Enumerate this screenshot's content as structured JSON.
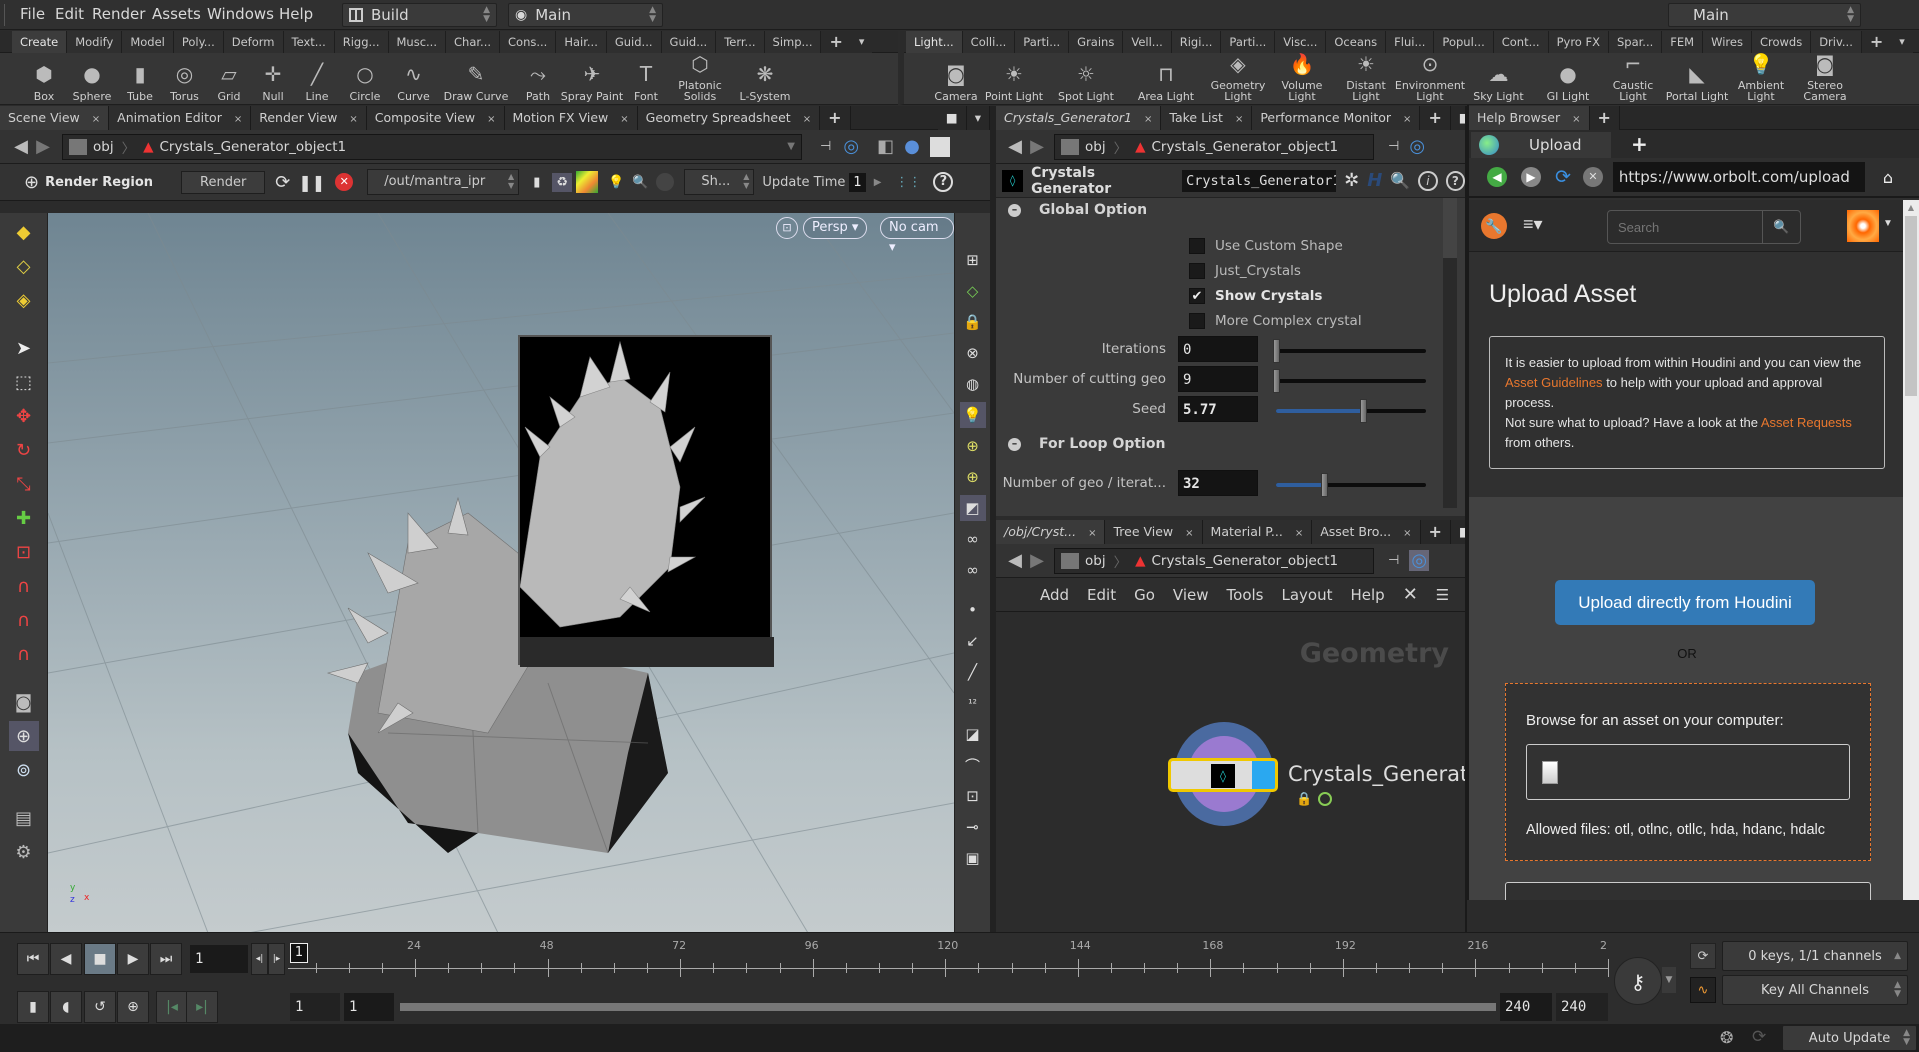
{
  "menubar": {
    "items": [
      "File",
      "Edit",
      "Render",
      "Assets",
      "Windows",
      "Help"
    ],
    "desktop": "Build",
    "context": "Main",
    "right_context": "Main"
  },
  "shelf_left": {
    "tabs": [
      "Create",
      "Modify",
      "Model",
      "Poly...",
      "Deform",
      "Text...",
      "Rigg...",
      "Musc...",
      "Char...",
      "Cons...",
      "Hair...",
      "Guid...",
      "Guid...",
      "Terr...",
      "Simp..."
    ],
    "active_tab": "Create",
    "tools": [
      "Box",
      "Sphere",
      "Tube",
      "Torus",
      "Grid",
      "Null",
      "Line",
      "Circle",
      "Curve",
      "Draw Curve",
      "Path",
      "Spray Paint",
      "Font",
      "Platonic Solids",
      "L-System"
    ]
  },
  "shelf_right": {
    "tabs": [
      "Light...",
      "Colli...",
      "Parti...",
      "Grains",
      "Vell...",
      "Rigi...",
      "Parti...",
      "Visc...",
      "Oceans",
      "Flui...",
      "Popul...",
      "Cont...",
      "Pyro FX",
      "Spar...",
      "FEM",
      "Wires",
      "Crowds",
      "Driv..."
    ],
    "active_tab": "Light...",
    "tools": [
      "Camera",
      "Point Light",
      "Spot Light",
      "Area Light",
      "Geometry Light",
      "Volume Light",
      "Distant Light",
      "Environment Light",
      "Sky Light",
      "GI Light",
      "Caustic Light",
      "Portal Light",
      "Ambient Light",
      "Stereo Camera"
    ]
  },
  "scene_pane": {
    "tabs": [
      "Scene View",
      "Animation Editor",
      "Render View",
      "Composite View",
      "Motion FX View",
      "Geometry Spreadsheet"
    ],
    "active_tab": "Scene View",
    "path": {
      "root": "obj",
      "node": "Crystals_Generator_object1"
    },
    "render_toolbar": {
      "render_region_label": "Render Region",
      "render_button": "Render",
      "output_driver": "/out/mantra_ipr",
      "shading_menu": "Sh...",
      "update_time_label": "Update Time",
      "update_time_value": "1"
    },
    "viewport": {
      "projection": "Persp",
      "camera": "No cam"
    }
  },
  "param_pane": {
    "tabs": [
      "Crystals_Generator1",
      "Take List",
      "Performance Monitor"
    ],
    "active_tab": "Crystals_Generator1",
    "path": {
      "root": "obj",
      "node": "Crystals_Generator_object1"
    },
    "node_type": "Crystals Generator",
    "node_name": "Crystals_Generator1",
    "sections": [
      {
        "title": "Global Option"
      },
      {
        "title": "For Loop Option"
      }
    ],
    "toggles": [
      {
        "label": "Use Custom Shape",
        "checked": false
      },
      {
        "label": "Just_Crystals",
        "checked": false
      },
      {
        "label": "Show Crystals",
        "checked": true
      },
      {
        "label": "More Complex crystal",
        "checked": false
      }
    ],
    "params": [
      {
        "label": "Iterations",
        "value": "0",
        "slider_fraction": 0.0
      },
      {
        "label": "Number of cutting geo",
        "value": "9",
        "slider_fraction": 0.0
      },
      {
        "label": "Seed",
        "value": "5.77",
        "slider_fraction": 0.577
      },
      {
        "label": "Number of geo / iterat...",
        "value": "32",
        "slider_fraction": 0.32
      }
    ]
  },
  "network_pane": {
    "tabs": [
      "/obj/Cryst...",
      "Tree View",
      "Material P...",
      "Asset Bro..."
    ],
    "active_tab": "/obj/Cryst...",
    "path": {
      "root": "obj",
      "node": "Crystals_Generator_object1"
    },
    "menu": [
      "Add",
      "Edit",
      "Go",
      "View",
      "Tools",
      "Layout",
      "Help"
    ],
    "context_label": "Geometry",
    "node_label": "Crystals_Generat"
  },
  "help_browser": {
    "pane_tab": "Help Browser",
    "browser_tab": "Upload",
    "url": "https://www.orbolt.com/upload",
    "search_placeholder": "Search",
    "heading": "Upload Asset",
    "info_text_1": "It is easier to upload from within Houdini and you can view the",
    "info_link_1": "Asset Guidelines",
    "info_text_2": "to help with your upload and approval process.",
    "info_text_3": "Not sure what to upload? Have a look at the",
    "info_link_2": "Asset Requests",
    "info_text_4": "from others.",
    "upload_button": "Upload directly from Houdini",
    "or_label": "OR",
    "browse_label": "Browse for an asset on your computer:",
    "allowed_files": "Allowed files: otl, otlnc, otllc, hda, hdanc, hdalc",
    "colors": {
      "link": "#e8772e",
      "button": "#337ab7",
      "dropzone_border": "#e8772e"
    }
  },
  "timeline": {
    "current_frame": "1",
    "frame_marker": "1",
    "ticks": [
      "24",
      "48",
      "72",
      "96",
      "120",
      "144",
      "168",
      "192",
      "216",
      "2"
    ],
    "range_start": "1",
    "range_start2": "1",
    "range_end": "240",
    "range_end2": "240",
    "keys_status": "0 keys, 1/1 channels",
    "key_mode": "Key All Channels"
  },
  "statusbar": {
    "update_mode": "Auto Update"
  }
}
